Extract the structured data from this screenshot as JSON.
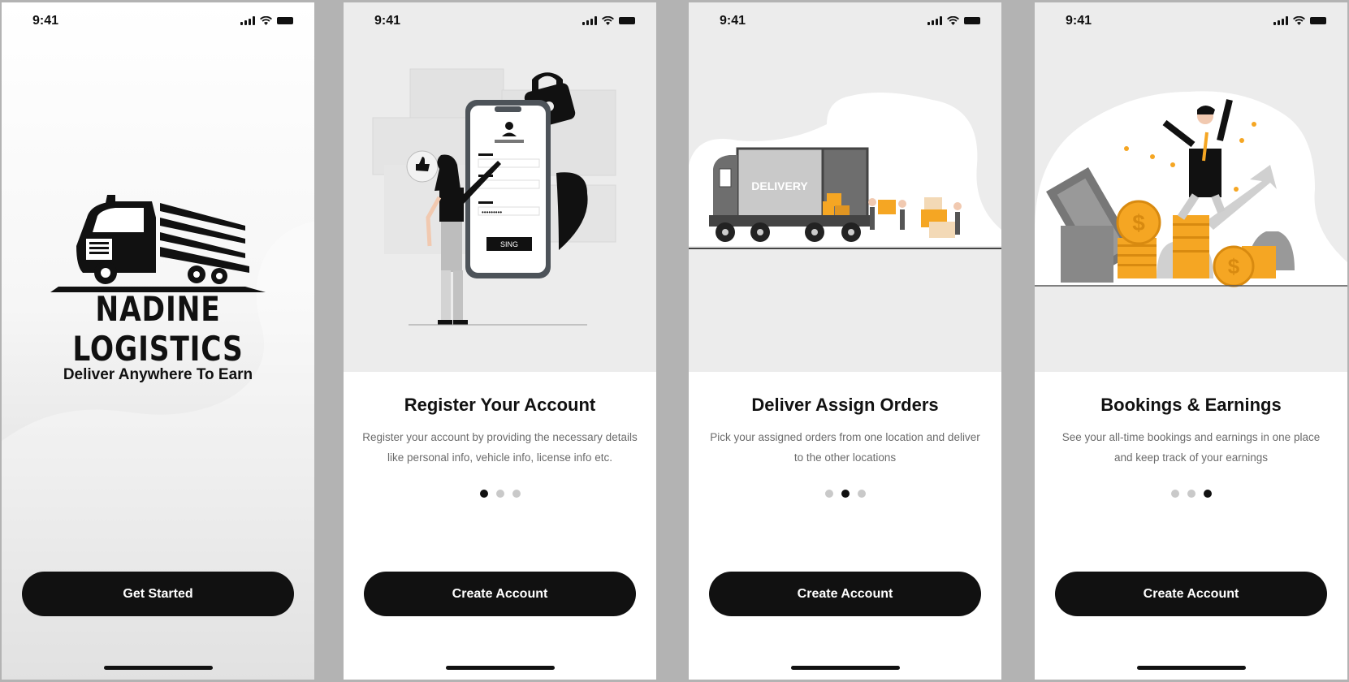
{
  "status_bar": {
    "time": "9:41"
  },
  "splash": {
    "brand_name": "NADINE LOGISTICS",
    "tagline": "Deliver Anywhere To Earn",
    "button_label": "Get Started"
  },
  "register": {
    "title": "Register Your Account",
    "description": "Register your account by providing the necessary details like personal info, vehicle info, license info etc.",
    "button_label": "Create Account",
    "illustration_button_text": "SING",
    "password_mask": "•••••••••",
    "active_dot": 1
  },
  "deliver": {
    "title": "Deliver Assign Orders",
    "description": "Pick your assigned orders from one location and deliver to the other locations",
    "button_label": "Create Account",
    "truck_label": "DELIVERY",
    "active_dot": 2
  },
  "earnings": {
    "title": "Bookings & Earnings",
    "description": "See your all-time bookings and earnings in one place and keep track of your earnings",
    "button_label": "Create Account",
    "coin_symbol": "$",
    "active_dot": 3
  },
  "colors": {
    "accent": "#111111",
    "coin": "#f5a623",
    "muted_text": "#6b6b6b"
  }
}
